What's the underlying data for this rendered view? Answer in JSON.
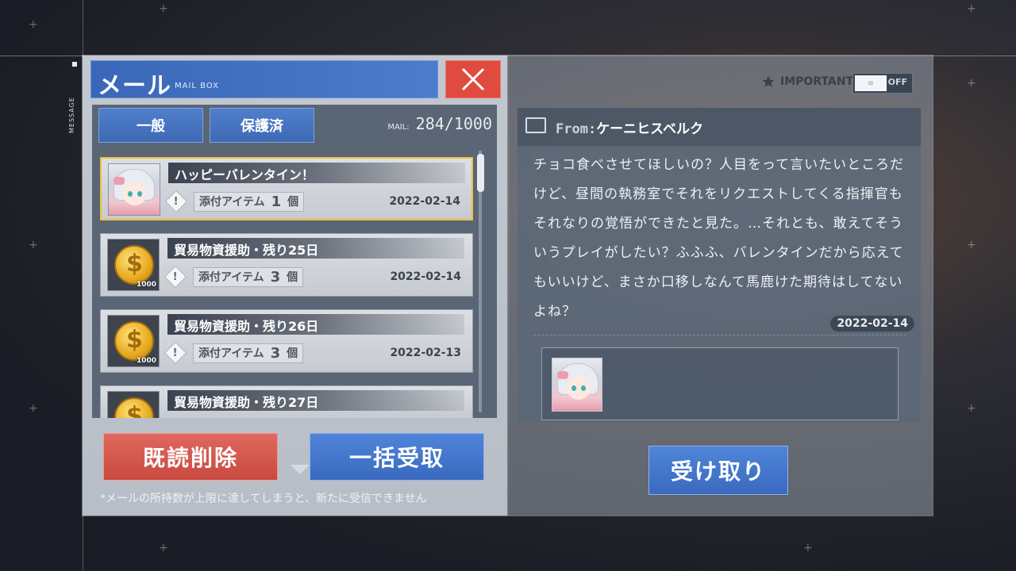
{
  "side_label": "MESSAGE",
  "mailbox": {
    "title": "メール",
    "subtitle": "MAIL BOX",
    "close_icon": "close-icon",
    "tabs": [
      {
        "label": "一般"
      },
      {
        "label": "保護済"
      }
    ],
    "mail_label": "MAIL:",
    "mail_count": "284/1000",
    "items": [
      {
        "title": "ハッピーバレンタイン！",
        "attach_label": "添付アイテム",
        "attach_count": "1",
        "attach_unit": "個",
        "date": "2022-02-14",
        "thumb": "character-portrait",
        "selected": true
      },
      {
        "title": "貿易物資援助・残り25日",
        "attach_label": "添付アイテム",
        "attach_count": "3",
        "attach_unit": "個",
        "date": "2022-02-14",
        "thumb": "coin",
        "thumb_label": "1000"
      },
      {
        "title": "貿易物資援助・残り26日",
        "attach_label": "添付アイテム",
        "attach_count": "3",
        "attach_unit": "個",
        "date": "2022-02-13",
        "thumb": "coin",
        "thumb_label": "1000"
      },
      {
        "title": "貿易物資援助・残り27日",
        "thumb": "coin"
      }
    ],
    "delete_read_label": "既読削除",
    "claim_all_label": "一括受取",
    "note": "*メールの所持数が上限に達してしまうと、新たに受信できません"
  },
  "detail": {
    "important_label": "IMPORTANT",
    "toggle_state": "OFF",
    "from_label": "From:",
    "from_name": "ケーニヒスベルク",
    "body": "チョコ食べさせてほしいの？人目をって言いたいところだけど、昼間の執務室でそれをリクエストしてくる指揮官もそれなりの覚悟ができたと見た。…それとも、敢えてそういうプレイがしたい？ふふふ、バレンタインだから応えてもいいけど、まさか口移しなんて馬鹿けた期待はしてないよね？",
    "date": "2022-02-14",
    "receive_label": "受け取り"
  },
  "colors": {
    "accent_blue": "#3e69b4",
    "danger_red": "#c84a40",
    "selected_border": "#f0c23a"
  }
}
